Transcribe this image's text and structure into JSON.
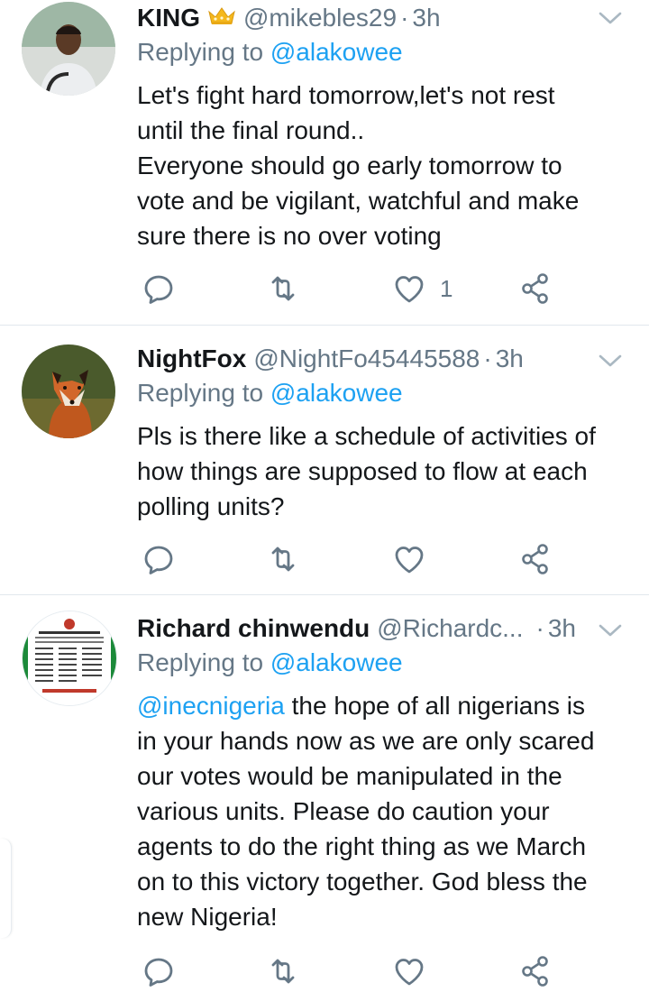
{
  "tweets": [
    {
      "name": "KING",
      "handle": "@mikebles29",
      "dot": "·",
      "time": "3h",
      "replying_prefix": "Replying to",
      "replying_to": "@alakowee",
      "text_lines": [
        "Let's fight hard tomorrow,let's not rest",
        "until the final round..",
        "Everyone should go early tomorrow to",
        "vote and be vigilant, watchful and make",
        "sure there is no over voting"
      ],
      "like_count": "1",
      "icons": [
        "crown-icon",
        "reply-icon",
        "retweet-icon",
        "like-icon",
        "share-icon",
        "chevron-down-icon"
      ]
    },
    {
      "name": "NightFox",
      "handle": "@NightFo45445588",
      "dot": "·",
      "time": "3h",
      "replying_prefix": "Replying to",
      "replying_to": "@alakowee",
      "text_lines": [
        "Pls is there like a schedule of activities of",
        "how things are supposed to flow at each",
        "polling units?"
      ],
      "like_count": "",
      "icons": [
        "reply-icon",
        "retweet-icon",
        "like-icon",
        "share-icon",
        "chevron-down-icon"
      ]
    },
    {
      "name": "Richard chinwendu",
      "handle": "@Richardc...",
      "dot": "·",
      "time": "3h",
      "replying_prefix": "Replying to",
      "replying_to": "@alakowee",
      "mention": "@inecnigeria",
      "text_first_rest": " the hope of all nigerians is",
      "text_lines": [
        "in your hands now as we are only scared",
        "our votes would be manipulated in the",
        "various units. Please do caution your",
        "agents to do the right thing as we March",
        "on to this victory together. God bless the",
        "new Nigeria!"
      ],
      "like_count": "",
      "icons": [
        "reply-icon",
        "retweet-icon",
        "like-icon",
        "share-icon",
        "chevron-down-icon"
      ]
    }
  ],
  "colors": {
    "text": "#14171a",
    "secondary": "#657786",
    "link": "#1da1f2",
    "divider": "#e1e8ed",
    "crown": "#f5b81c"
  }
}
